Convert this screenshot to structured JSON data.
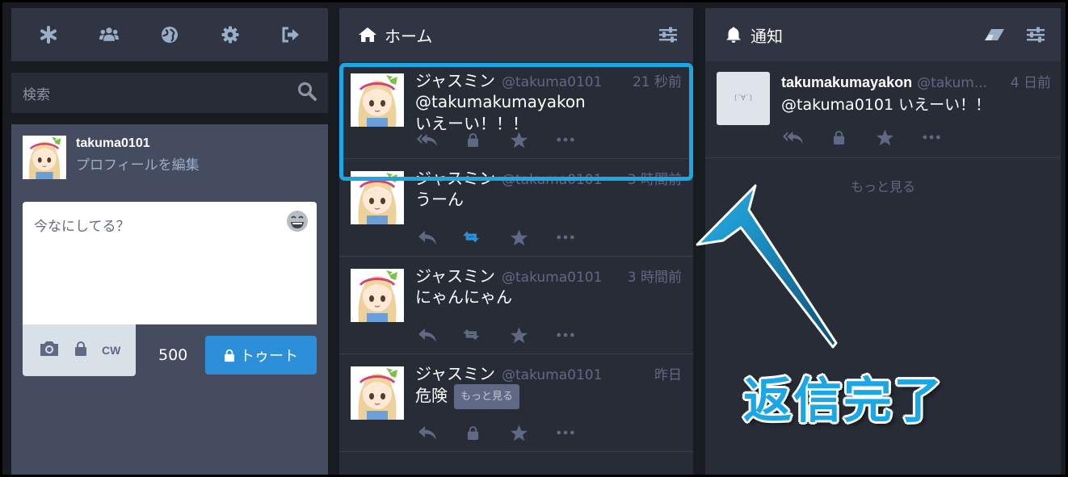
{
  "drawer": {
    "search_placeholder": "検索",
    "profile": {
      "username": "takuma0101",
      "edit_label": "プロフィールを編集"
    },
    "compose": {
      "placeholder": "今なにしてる？",
      "cw_label": "CW",
      "char_count": "500",
      "toot_label": "トゥート"
    }
  },
  "home": {
    "title": "ホーム",
    "statuses": [
      {
        "display_name": "ジャスミン",
        "acct": "@takuma0101",
        "time": "21 秒前",
        "content_lines": [
          "@takumakumayakon",
          "いえーい！！！"
        ]
      },
      {
        "display_name": "ジャスミン",
        "acct": "@takuma0101",
        "time": "3 時間前",
        "content_lines": [
          "うーん"
        ]
      },
      {
        "display_name": "ジャスミン",
        "acct": "@takuma0101",
        "time": "3 時間前",
        "content_lines": [
          "にゃんにゃん"
        ]
      },
      {
        "display_name": "ジャスミン",
        "acct": "@takuma0101",
        "time": "昨日",
        "content_lines": [
          "危険"
        ],
        "more_label": "もっと見る"
      }
    ]
  },
  "notifications": {
    "title": "通知",
    "item": {
      "display_name": "takumakumayakon",
      "acct": "@takum...",
      "time": "4 日前",
      "content": "@takuma0101 いえーい！！",
      "avatar_text": "(´∀`)"
    },
    "load_more": "もっと見る"
  },
  "annotation": "返信完了",
  "colors": {
    "accent": "#2b90d9",
    "highlight": "#1ba7e4",
    "boost_active": "#2b90d9"
  }
}
